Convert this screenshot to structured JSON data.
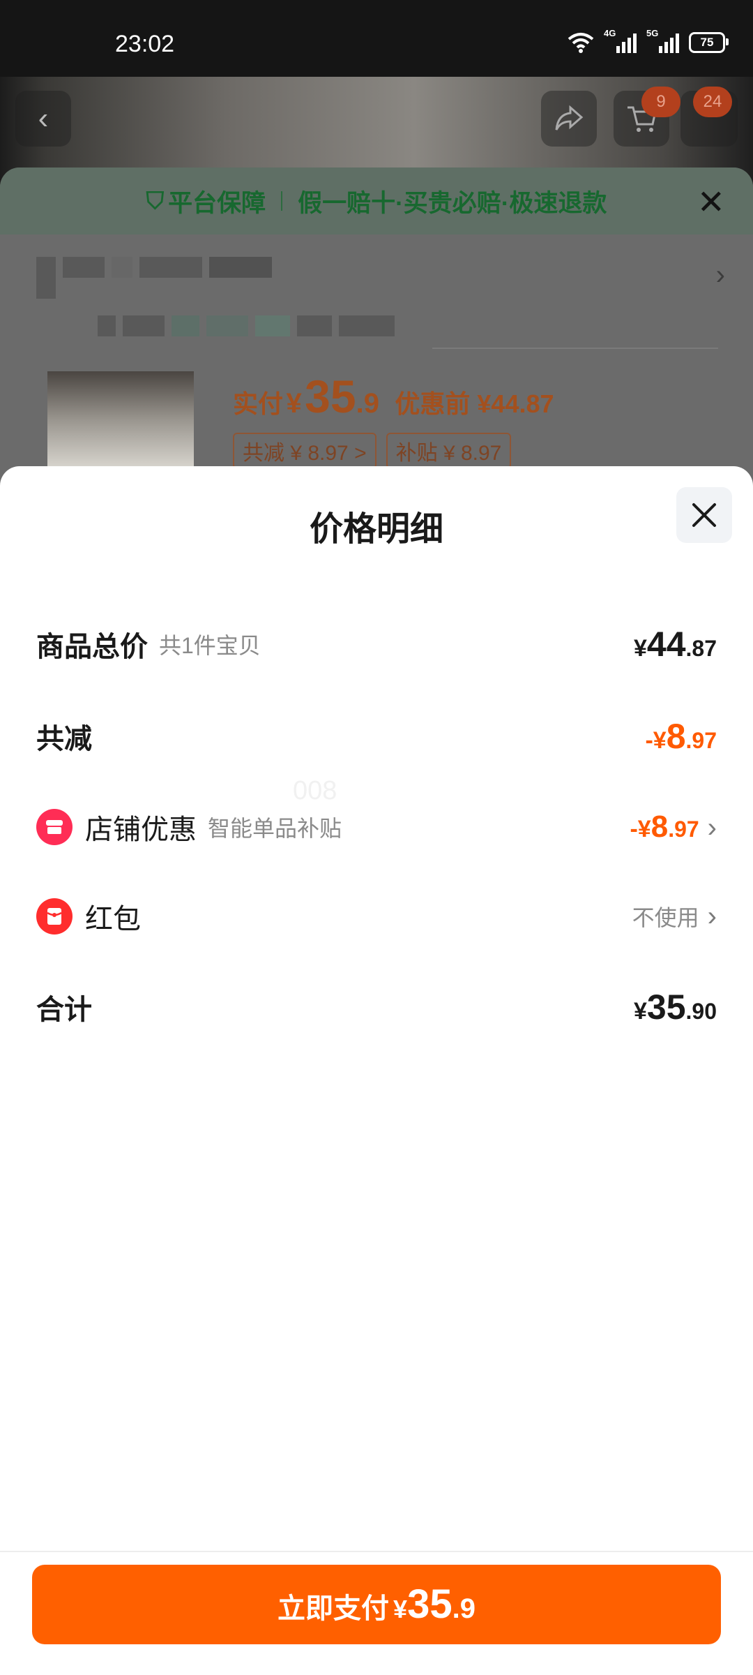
{
  "status_bar": {
    "time": "23:02",
    "network_4g": "4G",
    "network_5g": "5G",
    "battery": "75"
  },
  "top_nav": {
    "cart_badge": "9",
    "message_badge": "24"
  },
  "order": {
    "guarantee_main": "平台保障",
    "guarantee_detail": "假一赔十·买贵必赔·极速退款",
    "paid_label": "实付",
    "paid_yen": "¥",
    "paid_int": "35",
    "paid_dec": ".9",
    "before_discount": "优惠前 ¥44.87",
    "tag_reduce": "共减 ¥ 8.97 >",
    "tag_subsidy": "补贴 ¥ 8.97"
  },
  "sheet": {
    "title": "价格明细",
    "rows": {
      "total": {
        "label": "商品总价",
        "sub": "共1件宝贝",
        "yen": "¥",
        "int": "44",
        "dec": ".87"
      },
      "reduce": {
        "label": "共减",
        "yen": "-¥",
        "int": "8",
        "dec": ".97"
      },
      "shop": {
        "label": "店铺优惠",
        "sub": "智能单品补贴",
        "yen": "-¥",
        "int": "8",
        "dec": ".97"
      },
      "hongbao": {
        "label": "红包",
        "value": "不使用"
      },
      "sum": {
        "label": "合计",
        "yen": "¥",
        "int": "35",
        "dec": ".90"
      }
    },
    "watermark": "008"
  },
  "pay_button": {
    "label": "立即支付",
    "yen": "¥",
    "int": "35",
    "dec": ".9"
  },
  "colors": {
    "accent": "#ff6000",
    "discount": "#ff5a00",
    "shop_icon": "#ff2d55",
    "guarantee": "#17682f"
  }
}
